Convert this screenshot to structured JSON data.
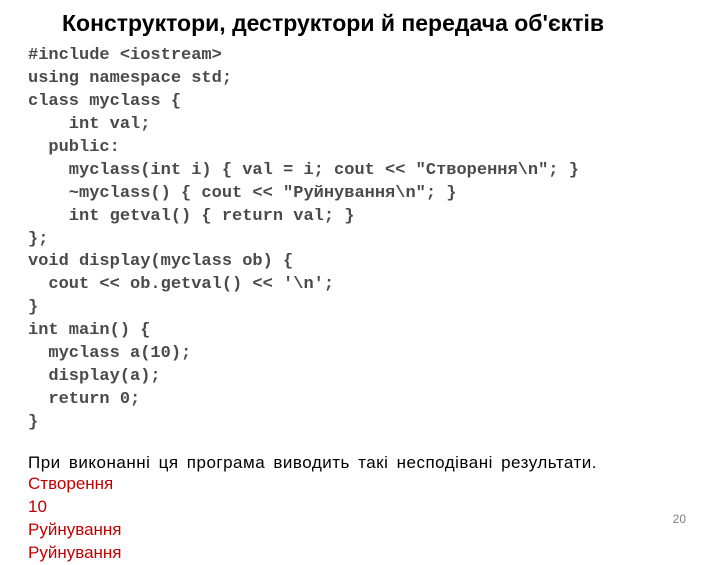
{
  "title": "Конструктори, деструктори й передача об'єктів",
  "code_lines": [
    "#include <iostream>",
    "using namespace std;",
    "class myclass {",
    "    int val;",
    "  public:",
    "    myclass(int i) { val = i; cout << \"Створення\\n\"; }",
    "    ~myclass() { cout << \"Руйнування\\n\"; }",
    "    int getval() { return val; }",
    "};",
    "void display(myclass ob) {",
    "  cout << ob.getval() << '\\n';",
    "}",
    "int main() {",
    "  myclass a(10);",
    "  display(a);",
    "  return 0;",
    "}"
  ],
  "explain_text": "При виконанні ця програма виводить такі несподівані результати.",
  "output_lines": [
    "Створення",
    "10",
    "Руйнування",
    "Руйнування"
  ],
  "page_number": "20"
}
